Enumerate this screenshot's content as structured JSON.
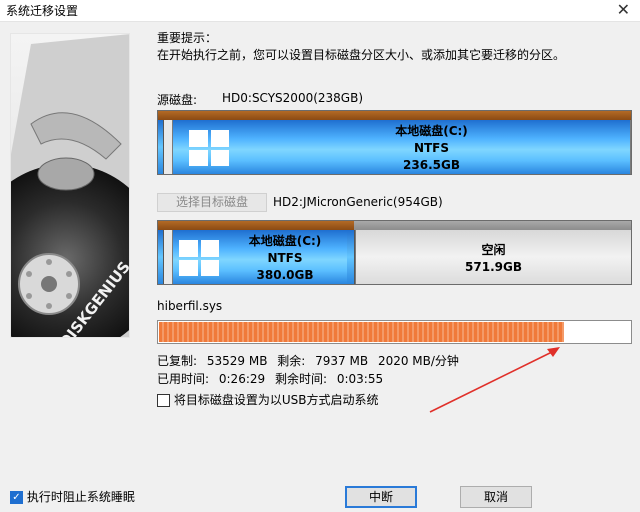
{
  "window": {
    "title": "系统迁移设置"
  },
  "hint": {
    "title": "重要提示：",
    "text": "在开始执行之前，您可以设置目标磁盘分区大小、或添加其它要迁移的分区。"
  },
  "source": {
    "label": "源磁盘:",
    "disk_name": "HD0:SCYS2000(238GB)",
    "partition": {
      "name": "本地磁盘(C:)",
      "fs": "NTFS",
      "size": "236.5GB"
    }
  },
  "target": {
    "select_button": "选择目标磁盘",
    "disk_name": "HD2:JMicronGeneric(954GB)",
    "partition": {
      "name": "本地磁盘(C:)",
      "fs": "NTFS",
      "size": "380.0GB"
    },
    "free": {
      "name": "空闲",
      "size": "571.9GB"
    }
  },
  "progress": {
    "current_file": "hiberfil.sys",
    "percent": 86,
    "copied_label": "已复制:",
    "copied_value": "53529 MB",
    "remaining_label": "剩余:",
    "remaining_value": "7937 MB",
    "speed": "2020 MB/分钟",
    "elapsed_label": "已用时间:",
    "elapsed_value": "0:26:29",
    "time_left_label": "剩余时间:",
    "time_left_value": "0:03:55"
  },
  "options": {
    "usb_boot": {
      "label": "将目标磁盘设置为以USB方式启动系统",
      "checked": false
    },
    "prevent_sleep": {
      "label": "执行时阻止系统睡眠",
      "checked": true
    }
  },
  "buttons": {
    "stop": "中断",
    "cancel": "取消"
  },
  "logo": {
    "text": "DISKGENIUS"
  },
  "colors": {
    "accent": "#1f6fd0",
    "progress": "#f07a3a",
    "arrow": "#e0302a",
    "partition_strip": "#9a5518"
  }
}
